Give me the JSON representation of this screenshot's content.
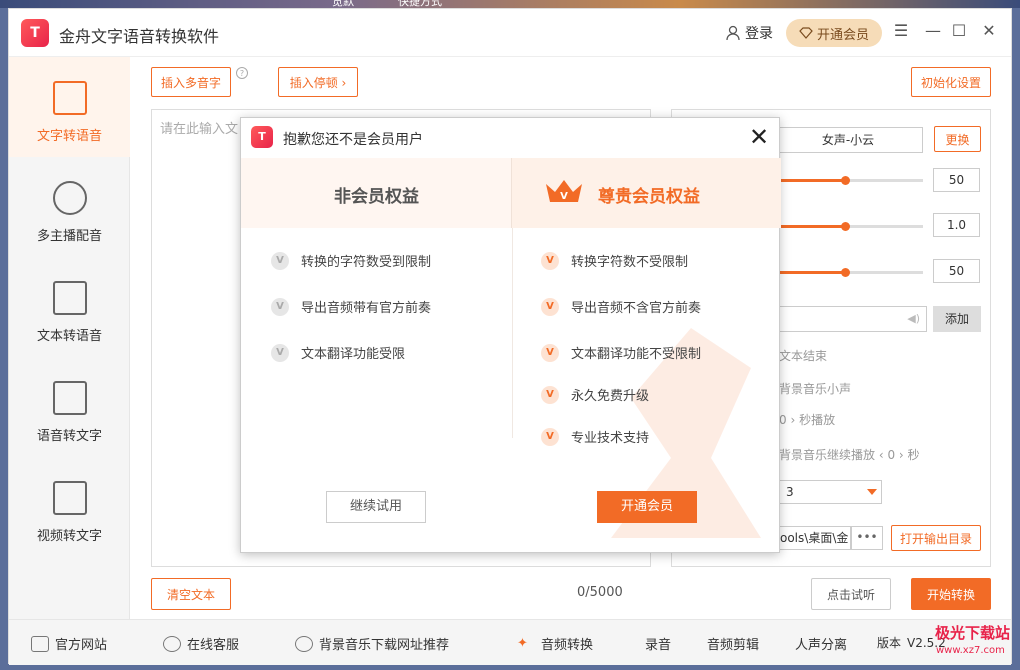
{
  "top_strip": {
    "left": "览默",
    "right": "快捷方式"
  },
  "app": {
    "logo_text": "T",
    "title": "金舟文字语音转换软件"
  },
  "header": {
    "login_label": "登录",
    "vip_label": "开通会员"
  },
  "sidebar": {
    "items": [
      {
        "label": "文字转语音",
        "icon": "tts-icon"
      },
      {
        "label": "多主播配音",
        "icon": "multi-anchor-icon"
      },
      {
        "label": "文本转语音",
        "icon": "text-doc-icon"
      },
      {
        "label": "语音转文字",
        "icon": "stt-icon"
      },
      {
        "label": "视频转文字",
        "icon": "video-text-icon"
      }
    ]
  },
  "toolbar": {
    "insert_polyphone": "插入多音字",
    "insert_pause": "插入停顿 ›",
    "init_settings": "初始化设置"
  },
  "editor": {
    "placeholder": "请在此输入文",
    "counter": "0/5000",
    "clear_label": "清空文本"
  },
  "settings": {
    "voice": "女声-小云",
    "change_label": "更换",
    "slider_values": [
      "50",
      "1.0",
      "50"
    ],
    "slider_fill": [
      0.46,
      0.46,
      0.46
    ],
    "add_label": "添加",
    "opt1": "文本结束",
    "opt2": "背景音乐小声",
    "opt3_value": "0",
    "opt3_suffix": "秒播放",
    "opt4": "背景音乐继续播放",
    "opt4_value": "0",
    "opt4_suffix": "秒",
    "format_value": "3",
    "path_value": "ools\\桌面\\金",
    "dots_label": "•••",
    "open_output_label": "打开输出目录",
    "preview_label": "点击试听",
    "start_label": "开始转换"
  },
  "bottom": {
    "items": [
      "官方网站",
      "在线客服",
      "背景音乐下载网址推荐",
      "音频转换",
      "录音",
      "音频剪辑",
      "人声分离"
    ],
    "version_prefix": "版本",
    "version": "V2.5.2",
    "watermark": "极光下载站",
    "watermark_url": "www.xz7.com"
  },
  "dialog": {
    "logo_text": "T",
    "title": "抱歉您还不是会员用户",
    "free_header": "非会员权益",
    "vip_header": "尊贵会员权益",
    "free_features": [
      "转换的字符数受到限制",
      "导出音频带有官方前奏",
      "文本翻译功能受限"
    ],
    "vip_features": [
      "转换字符数不受限制",
      "导出音频不含官方前奏",
      "文本翻译功能不受限制",
      "永久免费升级",
      "专业技术支持"
    ],
    "check_mark": "V",
    "try_label": "继续试用",
    "open_label": "开通会员"
  },
  "colors": {
    "accent": "#f26b26",
    "brand_red": "#e8234a",
    "vip_gold": "#f6dcb8"
  }
}
